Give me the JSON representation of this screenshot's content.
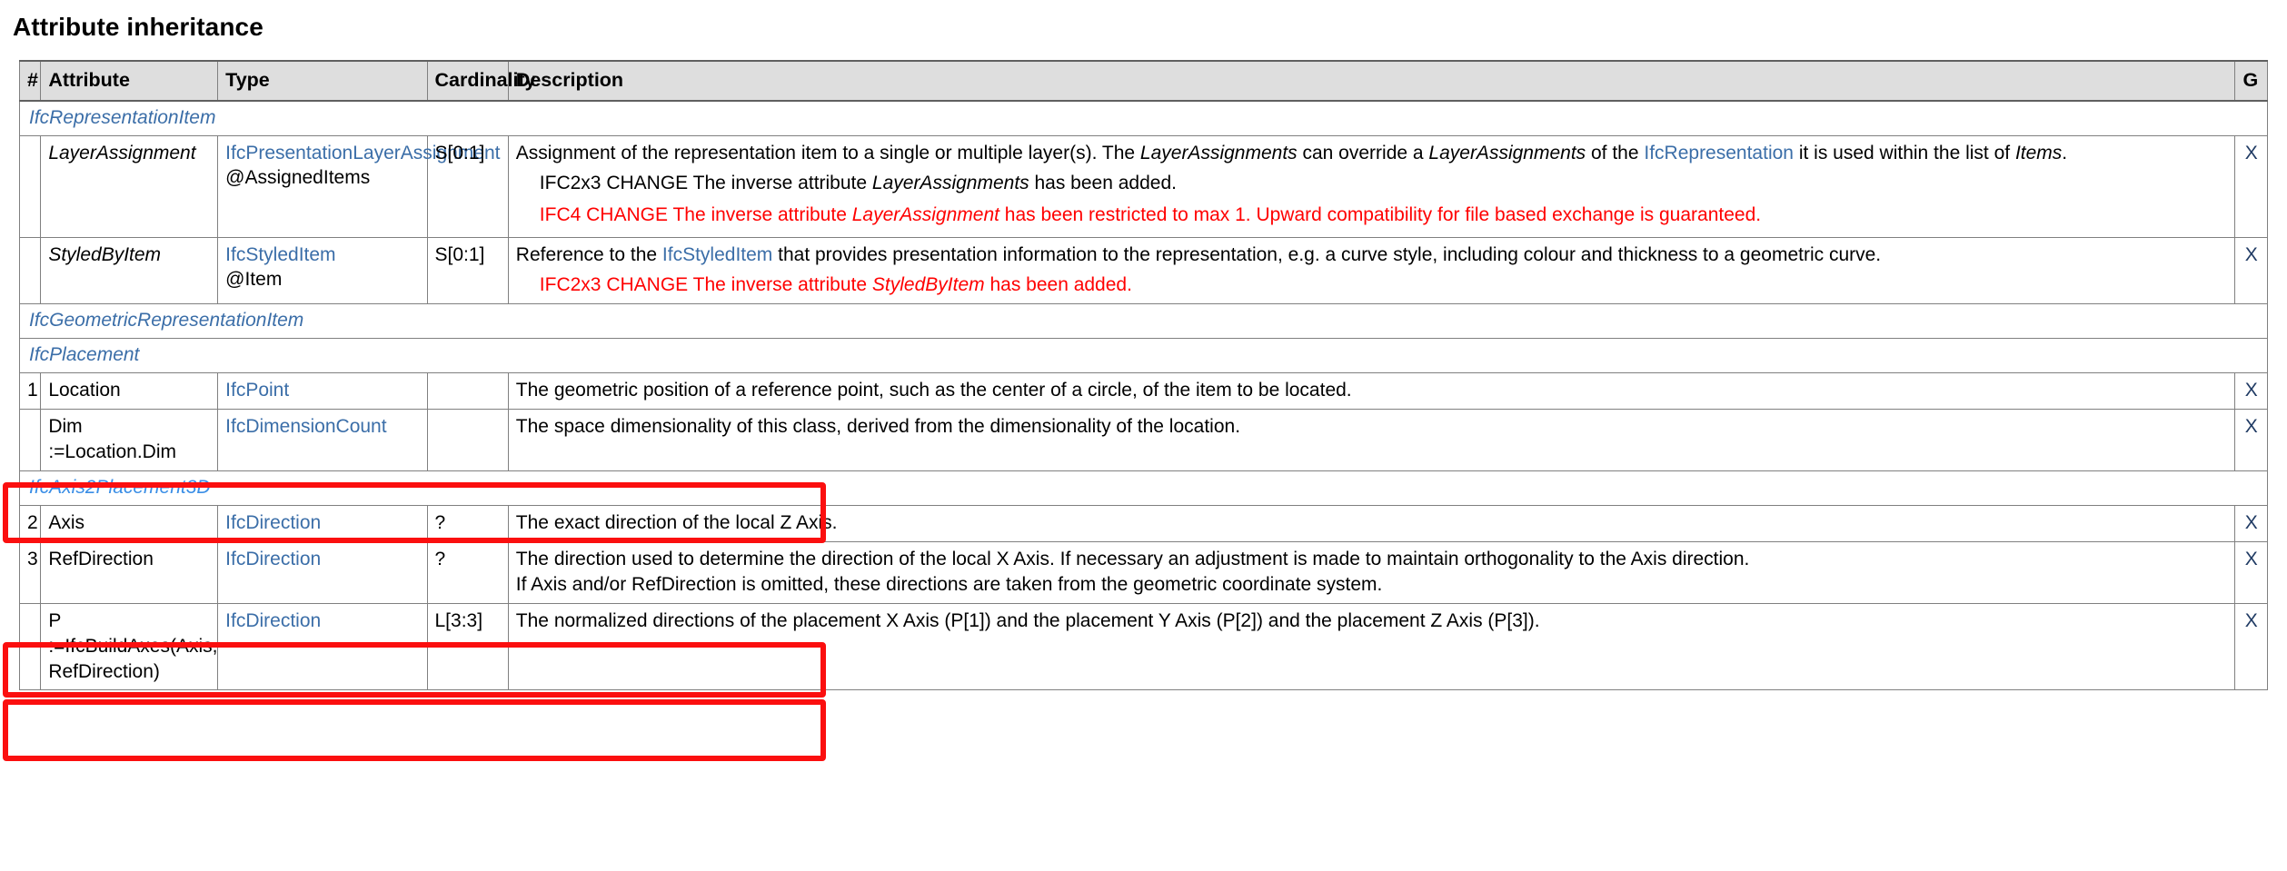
{
  "page": {
    "title": "Attribute inheritance"
  },
  "table": {
    "headers": {
      "num": "#",
      "attribute": "Attribute",
      "type": "Type",
      "cardinality": "Cardinality",
      "description": "Description",
      "g": "G"
    },
    "sections": [
      {
        "name": "IfcRepresentationItem"
      },
      {
        "name": "IfcGeometricRepresentationItem"
      },
      {
        "name": "IfcPlacement"
      },
      {
        "name": "IfcAxis2Placement3D"
      }
    ],
    "rows": {
      "layer_assignment": {
        "num": "",
        "attribute": "LayerAssignment",
        "type": "IfcPresentationLayerAssignment",
        "type_sub": "@AssignedItems",
        "cardinality": "S[0:1]",
        "desc_1a": "Assignment of the representation item to a single or multiple layer(s). The ",
        "desc_1b": "LayerAssignments",
        "desc_1c": " can override a ",
        "desc_1d": "LayerAssignments",
        "desc_1e": " of the ",
        "desc_1f": "IfcRepresentation",
        "desc_1g": " it is used within the list of ",
        "desc_1h": "Items",
        "desc_1i": ".",
        "change_2x3_label": "IFC2x3 CHANGE",
        "change_2x3_a": "  The inverse attribute ",
        "change_2x3_b": "LayerAssignments",
        "change_2x3_c": " has been added.",
        "change_4_label": "IFC4 CHANGE",
        "change_4_a": "  The inverse attribute ",
        "change_4_b": "LayerAssignment",
        "change_4_c": " has been restricted to max 1. Upward compatibility for file based exchange is guaranteed.",
        "g": "X"
      },
      "styled_by_item": {
        "num": "",
        "attribute": "StyledByItem",
        "type": "IfcStyledItem",
        "type_sub": "@Item",
        "cardinality": "S[0:1]",
        "desc_1a": "Reference to the ",
        "desc_1b": "IfcStyledItem",
        "desc_1c": " that provides presentation information to the representation, e.g. a curve style, including colour and thickness to a geometric curve.",
        "change_2x3_label": "IFC2x3 CHANGE",
        "change_2x3_a": "  The inverse attribute ",
        "change_2x3_b": "StyledByItem",
        "change_2x3_c": " has been added.",
        "g": "X"
      },
      "location": {
        "num": "1",
        "attribute": "Location",
        "type": "IfcPoint",
        "cardinality": "",
        "description": "The geometric position of a reference point, such as the center of a circle, of the item to be located.",
        "g": "X"
      },
      "dim": {
        "num": "",
        "attribute": "Dim",
        "attribute_sub": ":=Location.Dim",
        "type": "IfcDimensionCount",
        "cardinality": "",
        "description": "The space dimensionality of this class, derived from the dimensionality of the location.",
        "g": "X"
      },
      "axis": {
        "num": "2",
        "attribute": "Axis",
        "type": "IfcDirection",
        "cardinality": "?",
        "description": "The exact direction of the local Z Axis.",
        "g": "X"
      },
      "ref_direction": {
        "num": "3",
        "attribute": "RefDirection",
        "type": "IfcDirection",
        "cardinality": "?",
        "description_line1": "The direction used to determine the direction of the local X Axis. If necessary an adjustment is made to maintain orthogonality to the Axis direction.",
        "description_line2": "If Axis and/or RefDirection is omitted, these directions are taken from the geometric coordinate system.",
        "g": "X"
      },
      "p": {
        "num": "",
        "attribute": "P",
        "attribute_sub": ":=IfcBuildAxes(Axis, RefDirection)",
        "type": "IfcDirection",
        "cardinality": "L[3:3]",
        "description": "The normalized directions of the placement X Axis (P[1]) and the placement Y Axis (P[2]) and the placement Z Axis (P[3]).",
        "g": "X"
      }
    }
  },
  "annotations": {
    "highlight_color": "#fb0f0f",
    "boxes": [
      {
        "id": "redbox-location",
        "target": "location-row"
      },
      {
        "id": "redbox-axis",
        "target": "axis-row"
      },
      {
        "id": "redbox-refdir",
        "target": "ref-direction-row"
      }
    ]
  },
  "colors": {
    "link": "#3b6ea8",
    "link_light": "#5b9bd5",
    "header_bg": "#dedede",
    "border": "#808080",
    "change_red": "#ff0000"
  }
}
